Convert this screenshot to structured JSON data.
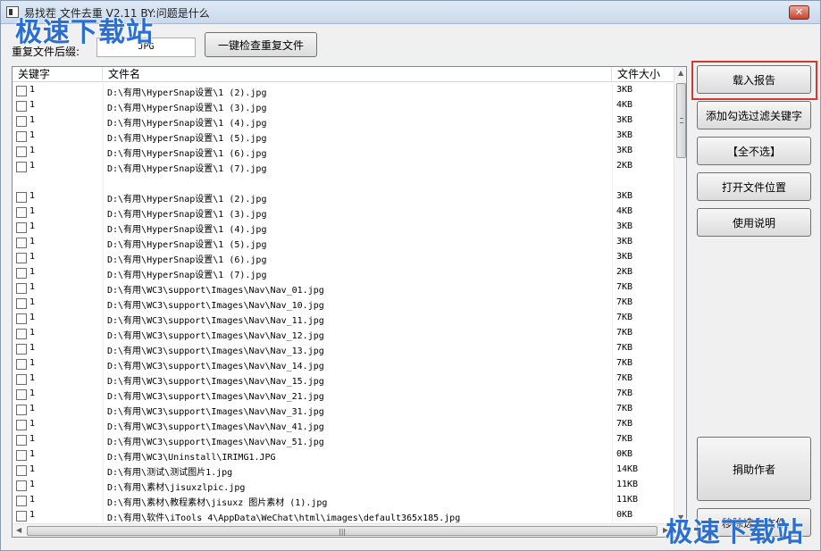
{
  "window": {
    "title": "易找茬 文件去重 V2.11   BY:问题是什么",
    "close_label": "✕"
  },
  "watermarks": {
    "top": "极速下载站",
    "bottom": "极速下载站"
  },
  "toolbar": {
    "suffix_label": "重复文件后缀:",
    "suffix_value": "JPG",
    "check_button": "一键检查重复文件"
  },
  "table": {
    "columns": [
      "关键字",
      "文件名",
      "文件大小"
    ],
    "rows": [
      {
        "key": "1",
        "name": "D:\\有用\\HyperSnap设置\\1 (2).jpg",
        "size": "3KB"
      },
      {
        "key": "1",
        "name": "D:\\有用\\HyperSnap设置\\1 (3).jpg",
        "size": "4KB"
      },
      {
        "key": "1",
        "name": "D:\\有用\\HyperSnap设置\\1 (4).jpg",
        "size": "3KB"
      },
      {
        "key": "1",
        "name": "D:\\有用\\HyperSnap设置\\1 (5).jpg",
        "size": "3KB"
      },
      {
        "key": "1",
        "name": "D:\\有用\\HyperSnap设置\\1 (6).jpg",
        "size": "3KB"
      },
      {
        "key": "1",
        "name": "D:\\有用\\HyperSnap设置\\1 (7).jpg",
        "size": "2KB"
      },
      {
        "key": "",
        "name": "",
        "size": "",
        "blank": true
      },
      {
        "key": "1",
        "name": "D:\\有用\\HyperSnap设置\\1 (2).jpg",
        "size": "3KB"
      },
      {
        "key": "1",
        "name": "D:\\有用\\HyperSnap设置\\1 (3).jpg",
        "size": "4KB"
      },
      {
        "key": "1",
        "name": "D:\\有用\\HyperSnap设置\\1 (4).jpg",
        "size": "3KB"
      },
      {
        "key": "1",
        "name": "D:\\有用\\HyperSnap设置\\1 (5).jpg",
        "size": "3KB"
      },
      {
        "key": "1",
        "name": "D:\\有用\\HyperSnap设置\\1 (6).jpg",
        "size": "3KB"
      },
      {
        "key": "1",
        "name": "D:\\有用\\HyperSnap设置\\1 (7).jpg",
        "size": "2KB"
      },
      {
        "key": "1",
        "name": "D:\\有用\\WC3\\support\\Images\\Nav\\Nav_01.jpg",
        "size": "7KB"
      },
      {
        "key": "1",
        "name": "D:\\有用\\WC3\\support\\Images\\Nav\\Nav_10.jpg",
        "size": "7KB"
      },
      {
        "key": "1",
        "name": "D:\\有用\\WC3\\support\\Images\\Nav\\Nav_11.jpg",
        "size": "7KB"
      },
      {
        "key": "1",
        "name": "D:\\有用\\WC3\\support\\Images\\Nav\\Nav_12.jpg",
        "size": "7KB"
      },
      {
        "key": "1",
        "name": "D:\\有用\\WC3\\support\\Images\\Nav\\Nav_13.jpg",
        "size": "7KB"
      },
      {
        "key": "1",
        "name": "D:\\有用\\WC3\\support\\Images\\Nav\\Nav_14.jpg",
        "size": "7KB"
      },
      {
        "key": "1",
        "name": "D:\\有用\\WC3\\support\\Images\\Nav\\Nav_15.jpg",
        "size": "7KB"
      },
      {
        "key": "1",
        "name": "D:\\有用\\WC3\\support\\Images\\Nav\\Nav_21.jpg",
        "size": "7KB"
      },
      {
        "key": "1",
        "name": "D:\\有用\\WC3\\support\\Images\\Nav\\Nav_31.jpg",
        "size": "7KB"
      },
      {
        "key": "1",
        "name": "D:\\有用\\WC3\\support\\Images\\Nav\\Nav_41.jpg",
        "size": "7KB"
      },
      {
        "key": "1",
        "name": "D:\\有用\\WC3\\support\\Images\\Nav\\Nav_51.jpg",
        "size": "7KB"
      },
      {
        "key": "1",
        "name": "D:\\有用\\WC3\\Uninstall\\IRIMG1.JPG",
        "size": "0KB"
      },
      {
        "key": "1",
        "name": "D:\\有用\\测试\\测试图片1.jpg",
        "size": "14KB"
      },
      {
        "key": "1",
        "name": "D:\\有用\\素材\\jisuxzlpic.jpg",
        "size": "11KB"
      },
      {
        "key": "1",
        "name": "D:\\有用\\素材\\教程素材\\jisuxz 图片素材 (1).jpg",
        "size": "11KB"
      },
      {
        "key": "1",
        "name": "D:\\有用\\软件\\iTools 4\\AppData\\WeChat\\html\\images\\default365x185.jpg",
        "size": "0KB"
      }
    ]
  },
  "sidebar": {
    "load_report": "载入报告",
    "add_filter": "添加勾选过滤关键字",
    "select_none": "【全不选】",
    "open_location": "打开文件位置",
    "instructions": "使用说明",
    "donate": "捐助作者",
    "remove_selected": "移除选中文件"
  },
  "colors": {
    "highlight": "#d23a31",
    "watermark": "#2b6fd0"
  }
}
